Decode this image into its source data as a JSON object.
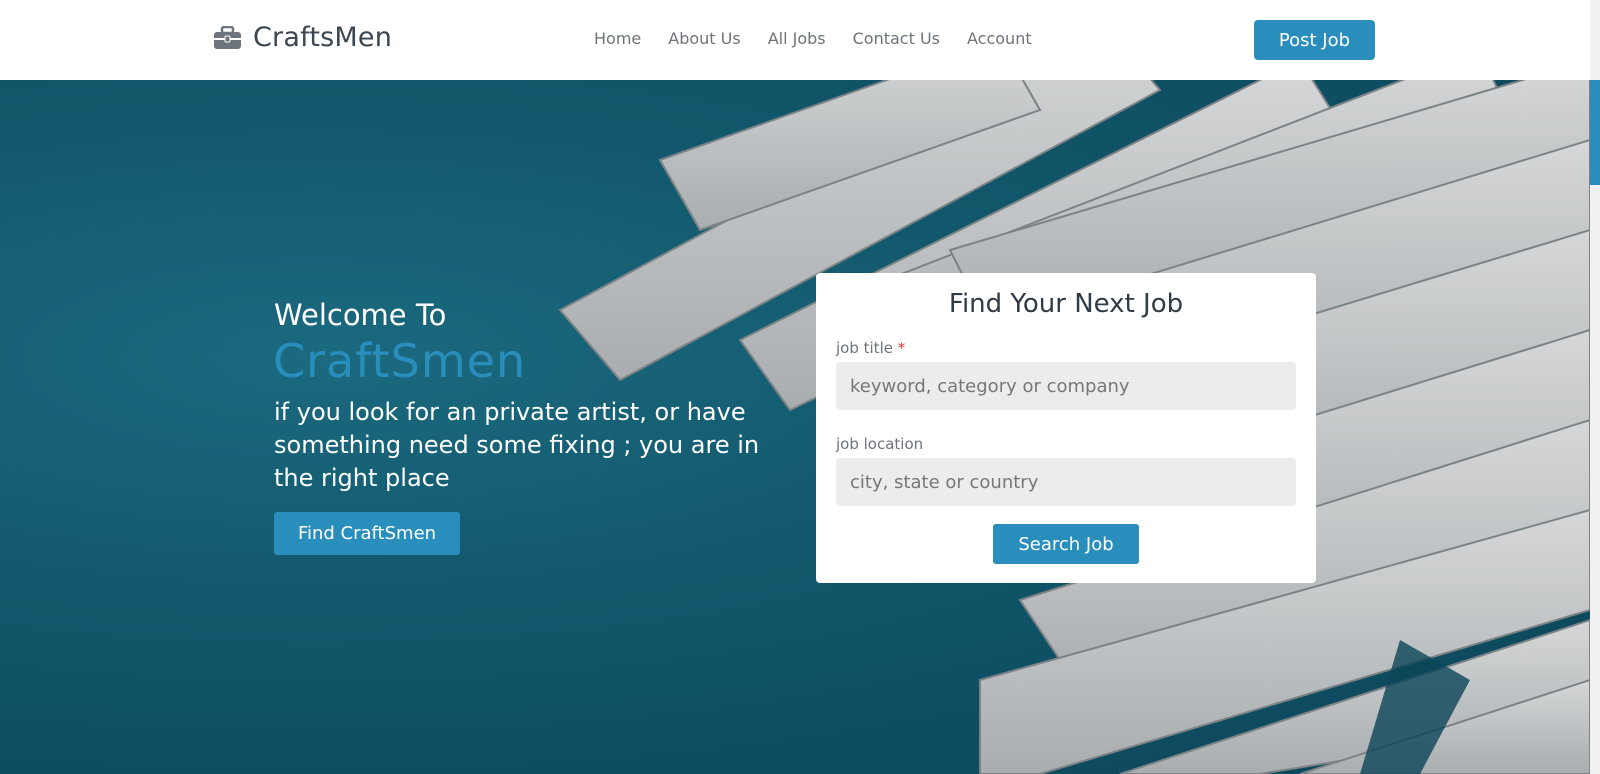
{
  "nav": {
    "brand": "CraftsMen",
    "brand_icon": "briefcase-icon",
    "links": [
      "Home",
      "About Us",
      "All Jobs",
      "Contact Us",
      "Account"
    ],
    "post_job_label": "Post Job"
  },
  "hero": {
    "welcome": "Welcome To",
    "brand": "CraftSmen",
    "tagline": "if you look for an private artist, or have something need some fixing ; you are in the right place",
    "find_button": "Find CraftSmen"
  },
  "search": {
    "title": "Find Your Next Job",
    "job_title_label": "job title",
    "required_mark": "*",
    "job_title_placeholder": "keyword, category or company",
    "job_location_label": "job location",
    "job_location_placeholder": "city, state or country",
    "button": "Search Job"
  },
  "colors": {
    "accent": "#2a8ebc",
    "hero_background": "#12586c"
  }
}
